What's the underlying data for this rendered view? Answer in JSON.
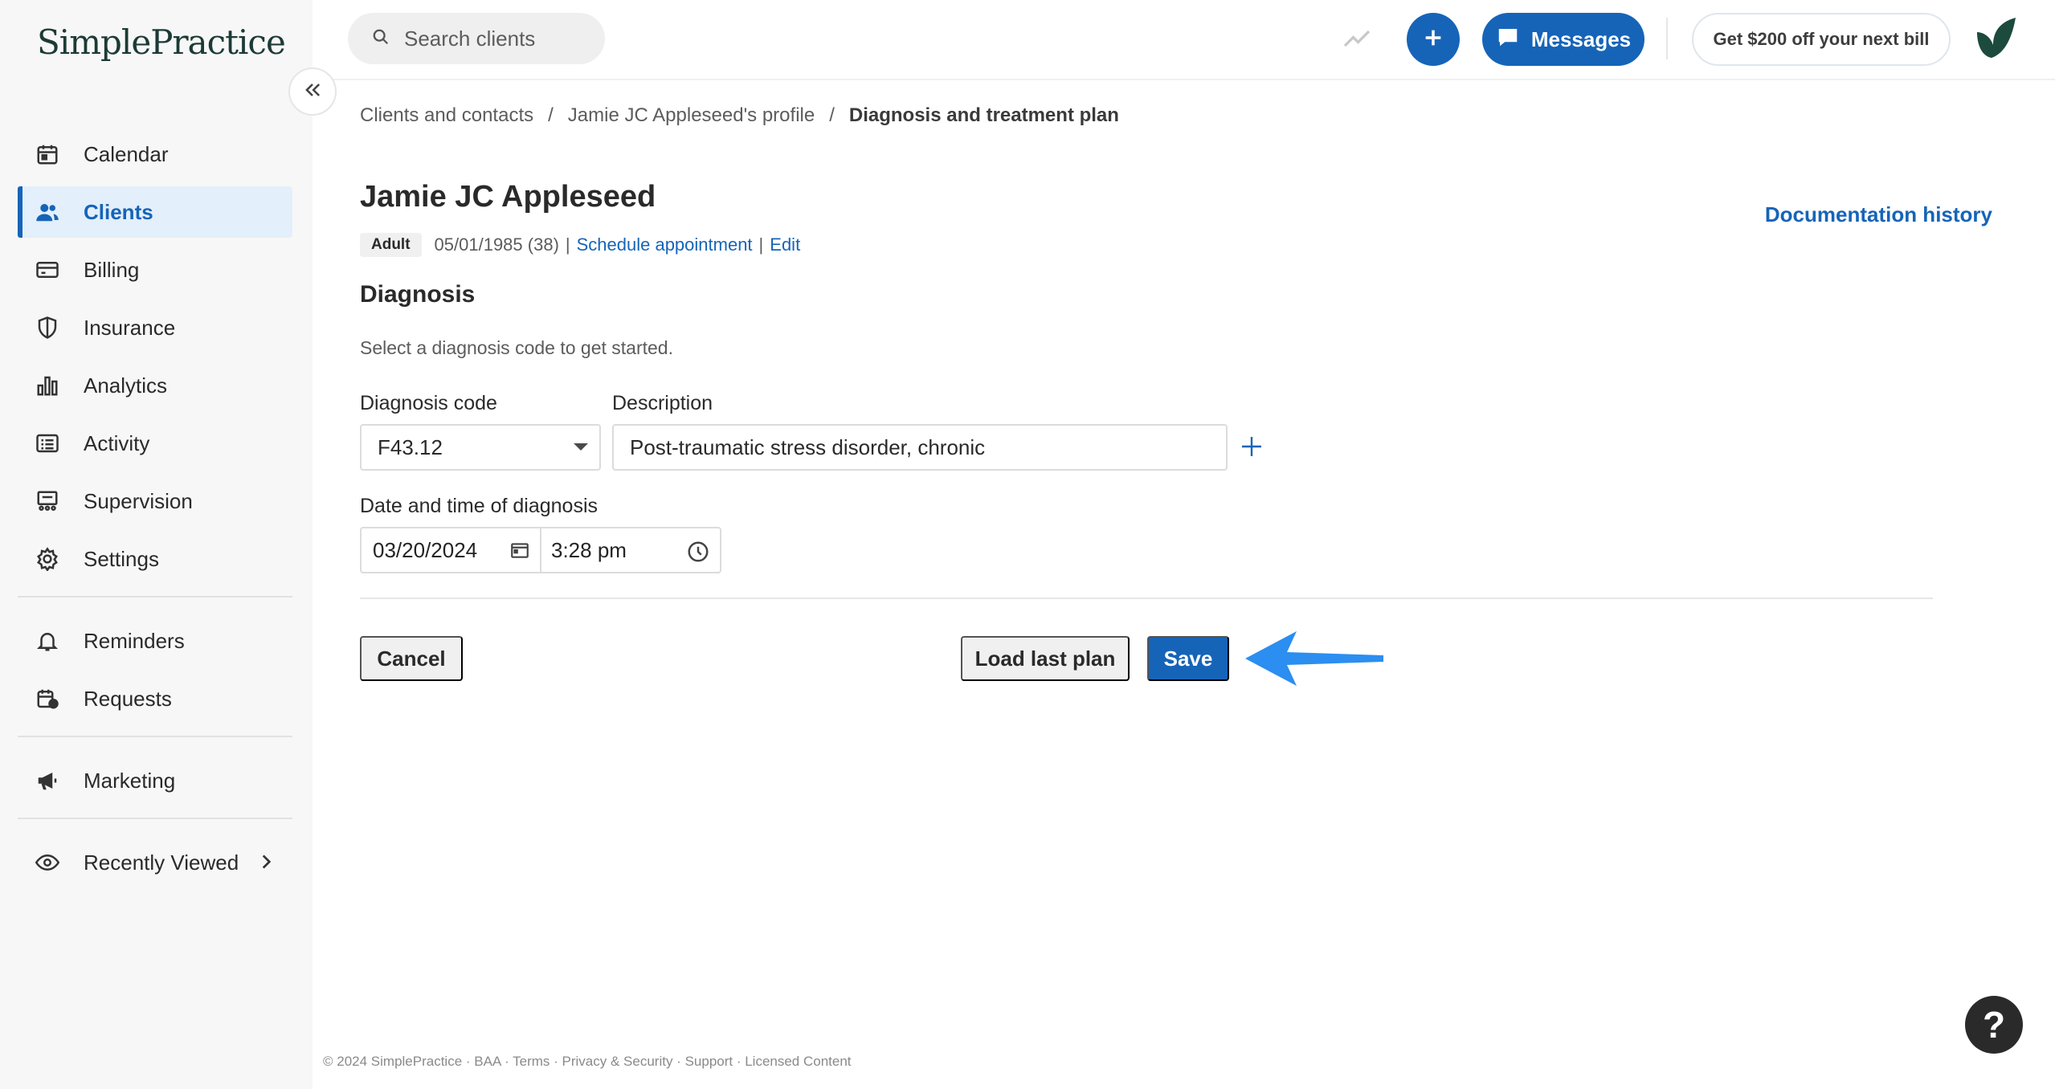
{
  "app": {
    "logo_text": "SimplePractice"
  },
  "sidebar": {
    "items": [
      {
        "label": "Calendar",
        "icon": "calendar-icon",
        "active": false
      },
      {
        "label": "Clients",
        "icon": "users-icon",
        "active": true
      },
      {
        "label": "Billing",
        "icon": "credit-card-icon",
        "active": false
      },
      {
        "label": "Insurance",
        "icon": "shield-icon",
        "active": false
      },
      {
        "label": "Analytics",
        "icon": "bar-chart-icon",
        "active": false
      },
      {
        "label": "Activity",
        "icon": "list-icon",
        "active": false
      },
      {
        "label": "Supervision",
        "icon": "supervision-icon",
        "active": false
      },
      {
        "label": "Settings",
        "icon": "gear-icon",
        "active": false
      }
    ],
    "secondary": [
      {
        "label": "Reminders",
        "icon": "bell-icon"
      },
      {
        "label": "Requests",
        "icon": "calendar-request-icon"
      }
    ],
    "marketing": {
      "label": "Marketing",
      "icon": "megaphone-icon"
    },
    "recently_viewed": {
      "label": "Recently Viewed",
      "icon": "eye-icon"
    }
  },
  "topbar": {
    "search_placeholder": "Search clients",
    "messages_label": "Messages",
    "promo_label": "Get $200 off your next bill"
  },
  "breadcrumb": {
    "items": [
      "Clients and contacts",
      "Jamie JC Appleseed's profile"
    ],
    "separator": "/",
    "current": "Diagnosis and treatment plan"
  },
  "client": {
    "name": "Jamie JC Appleseed",
    "badge": "Adult",
    "dob": "05/01/1985 (38)",
    "pipe": "|",
    "schedule_link": "Schedule appointment",
    "edit_link": "Edit"
  },
  "doc_history_label": "Documentation history",
  "diagnosis": {
    "title": "Diagnosis",
    "hint": "Select a diagnosis code to get started.",
    "code_label": "Diagnosis code",
    "code_value": "F43.12",
    "description_label": "Description",
    "description_value": "Post-traumatic stress disorder, chronic",
    "datetime_label": "Date and time of diagnosis",
    "date_value": "03/20/2024",
    "time_value": "3:28 pm"
  },
  "actions": {
    "cancel": "Cancel",
    "load_last_plan": "Load last plan",
    "save": "Save"
  },
  "footer": {
    "text": "© 2024 SimplePractice · BAA · Terms · Privacy & Security · Support · Licensed Content"
  },
  "help_label": "?",
  "colors": {
    "brand_blue": "#1664b8",
    "annotation_arrow": "#2b8ef0",
    "sidebar_bg": "#f7f7f7"
  }
}
